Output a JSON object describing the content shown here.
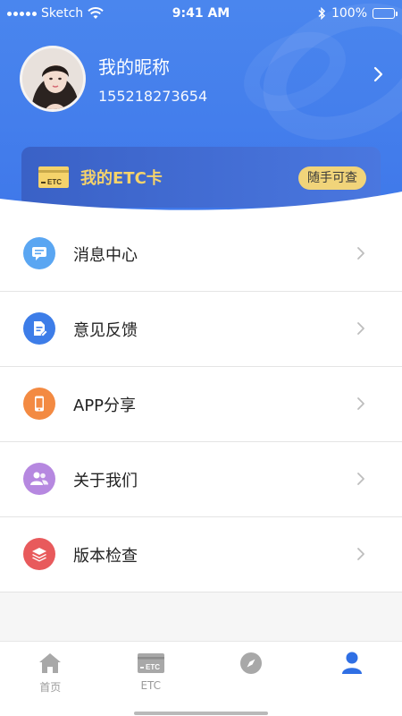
{
  "status_bar": {
    "carrier": "Sketch",
    "time": "9:41 AM",
    "battery": "100%"
  },
  "profile": {
    "nickname": "我的昵称",
    "phone": "155218273654"
  },
  "etc_card": {
    "title": "我的ETC卡",
    "tag": "随手可查",
    "icon_text": "ETC"
  },
  "menu": {
    "items": [
      {
        "label": "消息中心",
        "icon": "message-icon",
        "color": "#5aa6f2"
      },
      {
        "label": "意见反馈",
        "icon": "feedback-icon",
        "color": "#3d7de8"
      },
      {
        "label": "APP分享",
        "icon": "phone-share-icon",
        "color": "#f38a42"
      },
      {
        "label": "关于我们",
        "icon": "users-icon",
        "color": "#b688e0"
      },
      {
        "label": "版本检查",
        "icon": "layers-icon",
        "color": "#e85a5c"
      }
    ]
  },
  "tabbar": {
    "tabs": [
      {
        "label": "首页",
        "icon": "home-icon"
      },
      {
        "label": "ETC",
        "icon": "etc-card-icon"
      },
      {
        "label": "",
        "icon": "compass-icon"
      },
      {
        "label": "",
        "icon": "user-icon",
        "active": true
      }
    ],
    "active_color": "#2f6fe4",
    "inactive_color": "#9a9a9a"
  },
  "colors": {
    "header_blue": "#4a86ee",
    "card_gold": "#f5d36b"
  }
}
